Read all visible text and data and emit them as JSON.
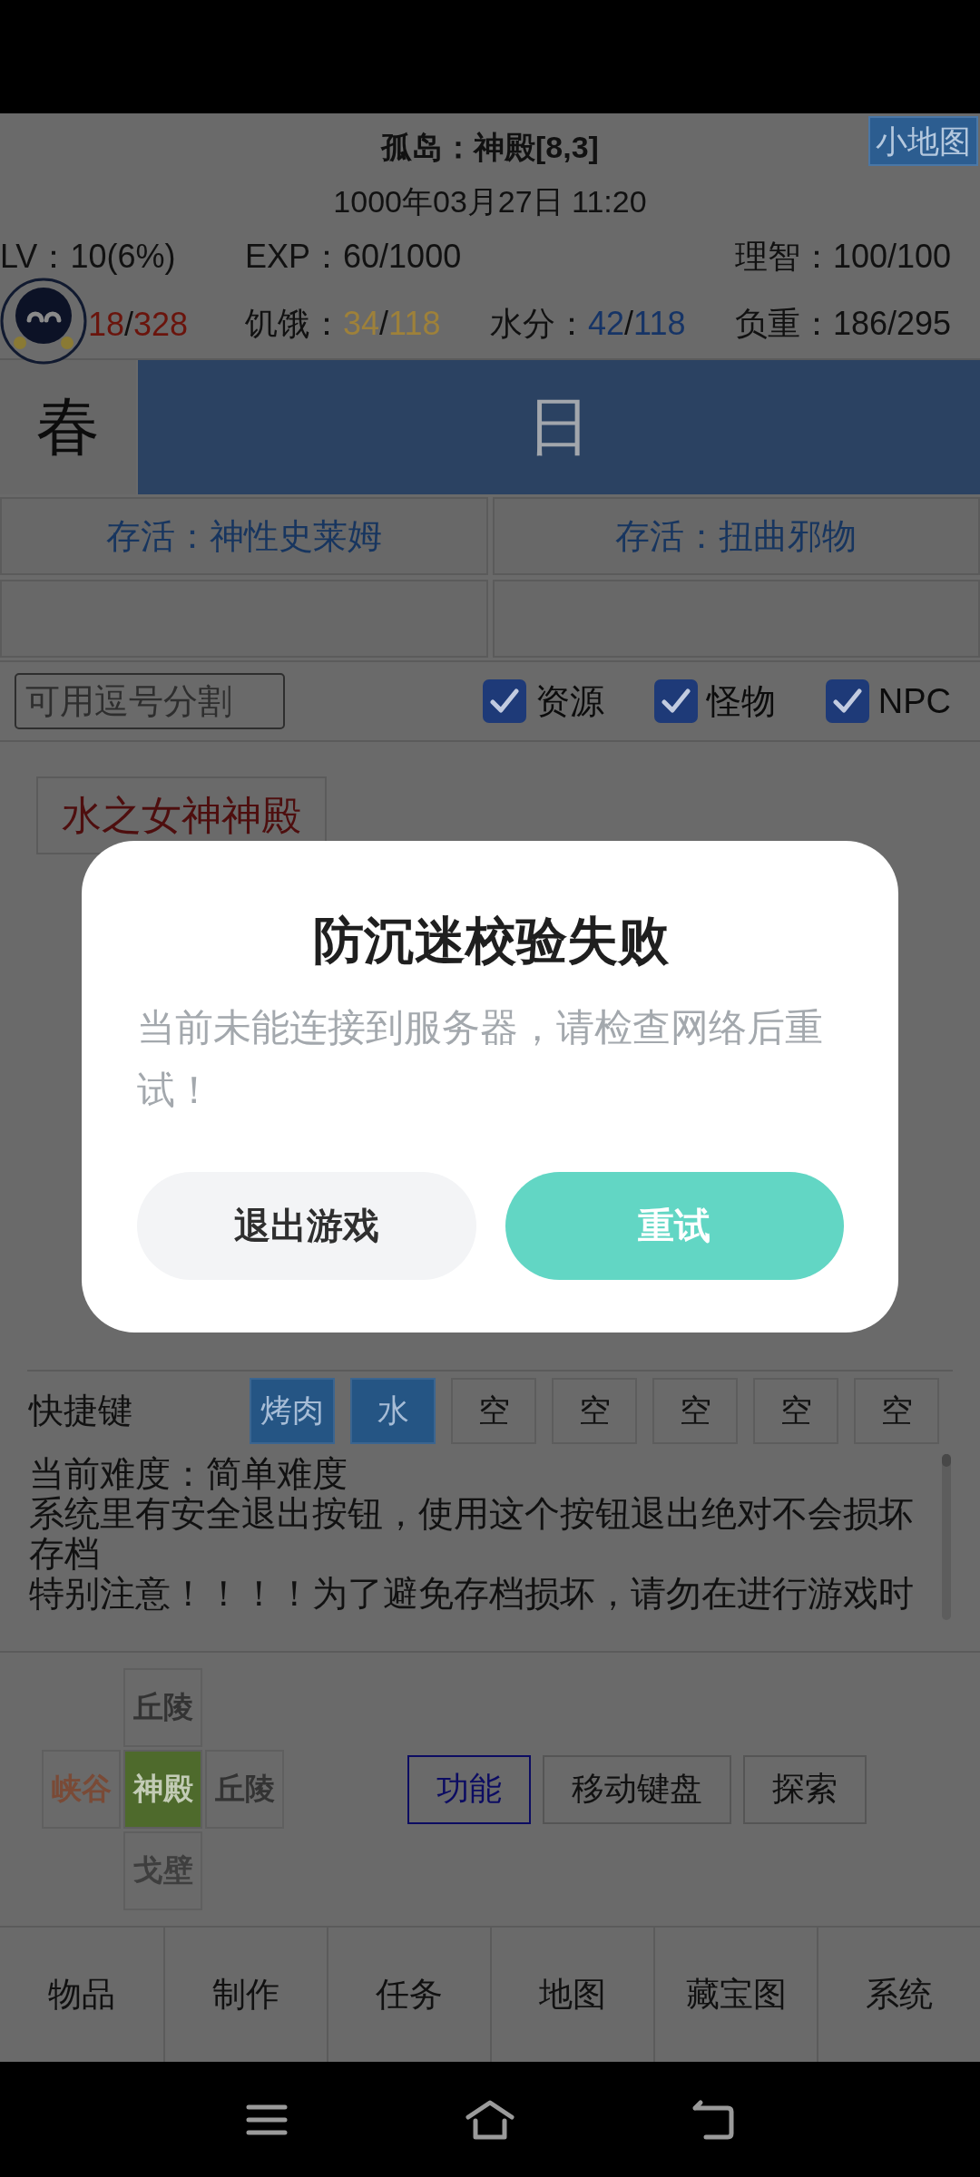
{
  "header": {
    "title": "孤岛：神殿[8,3]",
    "minimap_button": "小地图",
    "datetime": "1000年03月27日 11:20"
  },
  "stats": [
    [
      {
        "kind": "plain",
        "label": "LV：",
        "value": "10(6%)"
      },
      {
        "kind": "plain",
        "label": "EXP：",
        "value": "60/1000"
      },
      {
        "kind": "plain",
        "label": "理智：",
        "value": "100/100"
      }
    ],
    [
      {
        "kind": "gauge",
        "current": "18",
        "separator": "/",
        "max": "328",
        "color": "#6a140c"
      },
      {
        "kind": "gauge",
        "label": "饥饿：",
        "current": "34",
        "separator": "/",
        "max": "118",
        "color": "#9e813a"
      },
      {
        "kind": "gauge",
        "label": "水分：",
        "current": "42",
        "separator": "/",
        "max": "118",
        "color": "#163466"
      },
      {
        "kind": "plain",
        "label": "负重：",
        "value": "186/295"
      }
    ]
  ],
  "season": "春",
  "time_of_day": "日",
  "survival_tabs": [
    "存活：神性史莱姆",
    "存活：扭曲邪物"
  ],
  "filter": {
    "placeholder": "可用逗号分割",
    "options": [
      {
        "label": "资源",
        "checked": true
      },
      {
        "label": "怪物",
        "checked": true
      },
      {
        "label": "NPC",
        "checked": true
      }
    ]
  },
  "places": [
    "水之女神神殿"
  ],
  "shortcuts": {
    "label": "快捷键",
    "slots": [
      {
        "label": "烤肉",
        "filled": true
      },
      {
        "label": "水",
        "filled": true
      },
      {
        "label": "空",
        "filled": false
      },
      {
        "label": "空",
        "filled": false
      },
      {
        "label": "空",
        "filled": false
      },
      {
        "label": "空",
        "filled": false
      },
      {
        "label": "空",
        "filled": false
      }
    ]
  },
  "log": [
    "当前难度：简单难度",
    "系统里有安全退出按钮，使用这个按钮退出绝对不会损坏存档",
    "特别注意！！！！为了避免存档损坏，请勿在进行游戏时"
  ],
  "map": {
    "north": {
      "label": "丘陵",
      "color": "#333333",
      "current": false
    },
    "west": {
      "label": "峡谷",
      "color": "#7a4a36",
      "current": false
    },
    "center": {
      "label": "神殿",
      "color": "#c3ccb6",
      "current": true
    },
    "east": {
      "label": "丘陵",
      "color": "#333333",
      "current": false
    },
    "south": {
      "label": "戈壁",
      "color": "#3e3e3e",
      "current": false
    }
  },
  "action_buttons": [
    {
      "label": "功能",
      "selected": true
    },
    {
      "label": "移动键盘",
      "selected": false
    },
    {
      "label": "探索",
      "selected": false
    }
  ],
  "bottom_nav": [
    "物品",
    "制作",
    "任务",
    "地图",
    "藏宝图",
    "系统"
  ],
  "dialog": {
    "title": "防沉迷校验失败",
    "message": "当前未能连接到服务器，请检查网络后重试！",
    "buttons": [
      {
        "label": "退出游戏",
        "kind": "secondary"
      },
      {
        "label": "重试",
        "kind": "primary"
      }
    ]
  }
}
